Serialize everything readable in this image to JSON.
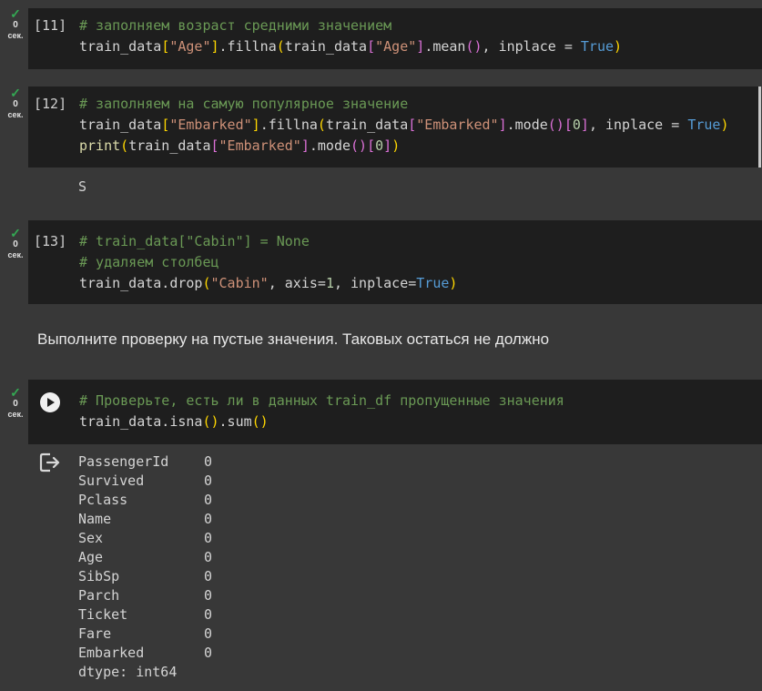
{
  "status_unit": "сек.",
  "cells": [
    {
      "exec_count": "[11]",
      "time": "0",
      "lines": [
        [
          [
            "c-com",
            "# заполняем возраст средними значением"
          ]
        ],
        [
          [
            "c-txt",
            "train_data"
          ],
          [
            "c-br1",
            "["
          ],
          [
            "c-str",
            "\"Age\""
          ],
          [
            "c-br1",
            "]"
          ],
          [
            "c-txt",
            ".fillna"
          ],
          [
            "c-br1",
            "("
          ],
          [
            "c-txt",
            "train_data"
          ],
          [
            "c-br2",
            "["
          ],
          [
            "c-str",
            "\"Age\""
          ],
          [
            "c-br2",
            "]"
          ],
          [
            "c-txt",
            ".mean"
          ],
          [
            "c-br2",
            "()"
          ],
          [
            "c-txt",
            ", inplace = "
          ],
          [
            "c-kw",
            "True"
          ],
          [
            "c-br1",
            ")"
          ]
        ]
      ]
    },
    {
      "exec_count": "[12]",
      "time": "0",
      "lines": [
        [
          [
            "c-com",
            "# заполняем на самую популярное значение"
          ]
        ],
        [
          [
            "c-txt",
            "train_data"
          ],
          [
            "c-br1",
            "["
          ],
          [
            "c-str",
            "\"Embarked\""
          ],
          [
            "c-br1",
            "]"
          ],
          [
            "c-txt",
            ".fillna"
          ],
          [
            "c-br1",
            "("
          ],
          [
            "c-txt",
            "train_data"
          ],
          [
            "c-br2",
            "["
          ],
          [
            "c-str",
            "\"Embarked\""
          ],
          [
            "c-br2",
            "]"
          ],
          [
            "c-txt",
            ".mode"
          ],
          [
            "c-br2",
            "()"
          ],
          [
            "c-br2",
            "["
          ],
          [
            "c-num",
            "0"
          ],
          [
            "c-br2",
            "]"
          ],
          [
            "c-txt",
            ", inplace = "
          ],
          [
            "c-kw",
            "True"
          ],
          [
            "c-br1",
            ")"
          ]
        ],
        [
          [
            "c-fn",
            "print"
          ],
          [
            "c-br1",
            "("
          ],
          [
            "c-txt",
            "train_data"
          ],
          [
            "c-br2",
            "["
          ],
          [
            "c-str",
            "\"Embarked\""
          ],
          [
            "c-br2",
            "]"
          ],
          [
            "c-txt",
            ".mode"
          ],
          [
            "c-br2",
            "()"
          ],
          [
            "c-br2",
            "["
          ],
          [
            "c-num",
            "0"
          ],
          [
            "c-br2",
            "]"
          ],
          [
            "c-br1",
            ")"
          ]
        ]
      ],
      "output": "S"
    },
    {
      "exec_count": "[13]",
      "time": "0",
      "lines": [
        [
          [
            "c-com",
            "# train_data[\"Cabin\"] = None"
          ]
        ],
        [
          [
            "c-com",
            "# удаляем столбец"
          ]
        ],
        [
          [
            "c-txt",
            "train_data.drop"
          ],
          [
            "c-br1",
            "("
          ],
          [
            "c-str",
            "\"Cabin\""
          ],
          [
            "c-txt",
            ", axis="
          ],
          [
            "c-num",
            "1"
          ],
          [
            "c-txt",
            ", inplace="
          ],
          [
            "c-kw",
            "True"
          ],
          [
            "c-br1",
            ")"
          ]
        ]
      ]
    },
    {
      "exec_count": "",
      "time": "0",
      "lines": [
        [
          [
            "c-com",
            "# Проверьте, есть ли в данных train_df пропущенные значения"
          ]
        ],
        [
          [
            "c-txt",
            "train_data.isna"
          ],
          [
            "c-br1",
            "()"
          ],
          [
            "c-txt",
            ".sum"
          ],
          [
            "c-br1",
            "()"
          ]
        ]
      ]
    }
  ],
  "markdown_text": "Выполните проверку на пустые значения. Таковых остаться не должно",
  "isna_output": {
    "rows": [
      {
        "name": "PassengerId",
        "value": "0"
      },
      {
        "name": "Survived",
        "value": "0"
      },
      {
        "name": "Pclass",
        "value": "0"
      },
      {
        "name": "Name",
        "value": "0"
      },
      {
        "name": "Sex",
        "value": "0"
      },
      {
        "name": "Age",
        "value": "0"
      },
      {
        "name": "SibSp",
        "value": "0"
      },
      {
        "name": "Parch",
        "value": "0"
      },
      {
        "name": "Ticket",
        "value": "0"
      },
      {
        "name": "Fare",
        "value": "0"
      },
      {
        "name": "Embarked",
        "value": "0"
      }
    ],
    "dtype": "dtype: int64"
  },
  "icons": {
    "status": "check-icon",
    "run": "play-icon",
    "output": "output-redirect-icon"
  },
  "colors": {
    "check": "#34a853",
    "cell_bg": "#1e1e1e",
    "page_bg": "#383838"
  }
}
